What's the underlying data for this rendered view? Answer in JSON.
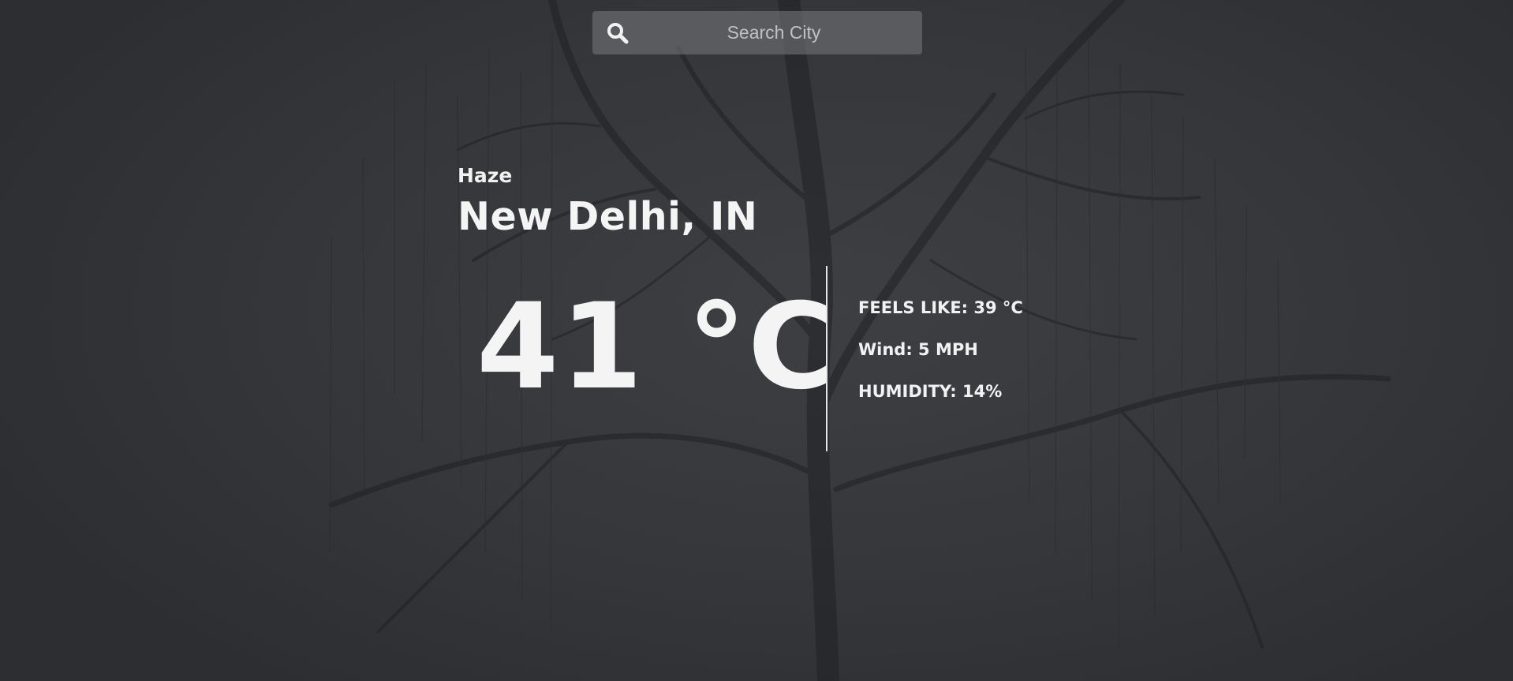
{
  "search": {
    "placeholder": "Search City",
    "value": ""
  },
  "weather": {
    "condition": "Haze",
    "city": "New Delhi, IN",
    "temperature": "41 °C",
    "feels_like": "FEELS LIKE: 39 °C",
    "wind": "Wind: 5 MPH",
    "humidity": "HUMIDITY: 14%"
  },
  "icons": {
    "search": "search-icon"
  },
  "colors": {
    "background": "#35373b",
    "text": "#f2f2f2",
    "search_bg": "#6b6d71"
  }
}
